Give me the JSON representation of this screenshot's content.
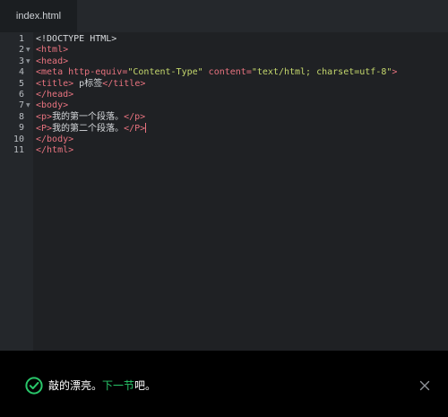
{
  "tab": {
    "filename": "index.html"
  },
  "editor": {
    "line_numbers": [
      "1",
      "2",
      "3",
      "4",
      "5",
      "6",
      "7",
      "8",
      "9",
      "10",
      "11"
    ],
    "foldable_lines": [
      "2",
      "3",
      "7"
    ],
    "lines": [
      [
        {
          "t": "doctype",
          "v": "<!DOCTYPE HTML>"
        }
      ],
      [
        {
          "t": "tag",
          "v": "<html>"
        }
      ],
      [
        {
          "t": "tag",
          "v": "<head>"
        }
      ],
      [
        {
          "t": "tag",
          "v": "<meta "
        },
        {
          "t": "attr",
          "v": "http-equiv="
        },
        {
          "t": "str",
          "v": "\"Content-Type\""
        },
        {
          "t": "attr",
          "v": " content="
        },
        {
          "t": "str",
          "v": "\"text/html; charset=utf-8\""
        },
        {
          "t": "tag",
          "v": ">"
        }
      ],
      [
        {
          "t": "tag",
          "v": "<title>"
        },
        {
          "t": "txt",
          "v": " p标签"
        },
        {
          "t": "tag",
          "v": "</title>"
        }
      ],
      [
        {
          "t": "tag",
          "v": "</head>"
        }
      ],
      [
        {
          "t": "tag",
          "v": "<body>"
        }
      ],
      [
        {
          "t": "tag",
          "v": "<p>"
        },
        {
          "t": "txt",
          "v": "我的第一个段落。"
        },
        {
          "t": "tag",
          "v": "</p>"
        }
      ],
      [
        {
          "t": "tag",
          "v": "<P>"
        },
        {
          "t": "txt",
          "v": "我的第二个段落。"
        },
        {
          "t": "tag",
          "v": "</P>"
        },
        {
          "t": "cursor",
          "v": ""
        }
      ],
      [
        {
          "t": "tag",
          "v": "</body>"
        }
      ],
      [
        {
          "t": "tag",
          "v": "</html>"
        }
      ]
    ]
  },
  "footer": {
    "message_before": "敲的漂亮。",
    "next_link": "下一节",
    "message_after": "吧。",
    "icons": {
      "success": "check-circle-icon",
      "close": "close-icon"
    },
    "colors": {
      "success": "#29c66a",
      "tag": "#e8737f",
      "string": "#c5d86d"
    }
  }
}
